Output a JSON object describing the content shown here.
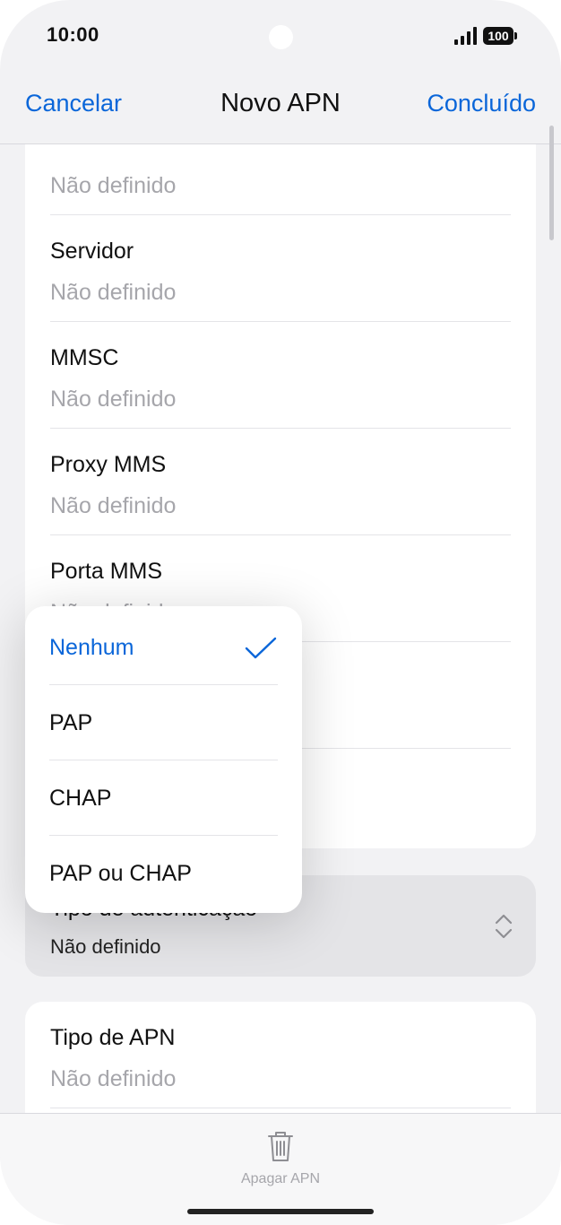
{
  "status": {
    "time": "10:00",
    "battery": "100"
  },
  "nav": {
    "cancel": "Cancelar",
    "title": "Novo APN",
    "done": "Concluído"
  },
  "fields": [
    {
      "label": "",
      "value": "Não definido"
    },
    {
      "label": "Servidor",
      "value": "Não definido"
    },
    {
      "label": "MMSC",
      "value": "Não definido"
    },
    {
      "label": "Proxy MMS",
      "value": "Não definido"
    },
    {
      "label": "Porta MMS",
      "value": "Não definido"
    }
  ],
  "auth": {
    "label": "Tipo de autenticação",
    "value": "Não definido"
  },
  "apn_type": {
    "label": "Tipo de APN",
    "value": "Não definido"
  },
  "auth_menu": {
    "options": [
      "Nenhum",
      "PAP",
      "CHAP",
      "PAP ou CHAP"
    ],
    "selected": "Nenhum"
  },
  "toolbar": {
    "delete_label": "Apagar APN"
  },
  "colors": {
    "accent": "#0a66d9",
    "placeholder": "#a6a6ab"
  }
}
